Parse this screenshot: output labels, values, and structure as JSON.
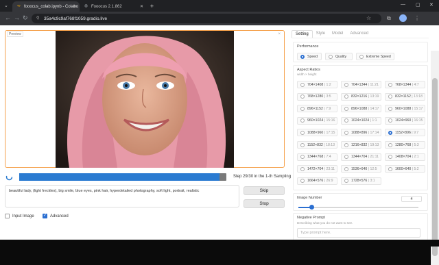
{
  "browser": {
    "tabs": [
      {
        "label": "fooocus_colab.ipynb - Colabo",
        "active": true
      },
      {
        "label": "Fooocus 2.1.862",
        "active": false
      }
    ],
    "url": "35a4c9c9af768f1059.gradio.live"
  },
  "preview": {
    "label": "Preview"
  },
  "progress": {
    "fraction": 0.967,
    "text": "Step 29/30 in the 1-th Sampling"
  },
  "prompt": {
    "value": "beautiful lady, (light freckles), big smile, blue eyes, pink hair, hyperdetailed photography, soft light, portrait, realistic"
  },
  "buttons": {
    "skip": "Skip",
    "stop": "Stop"
  },
  "options": {
    "input_image": "Input Image",
    "advanced": "Advanced"
  },
  "settings_tabs": [
    "Setting",
    "Style",
    "Model",
    "Advanced"
  ],
  "performance": {
    "title": "Performance",
    "options": [
      "Speed",
      "Quality",
      "Extreme Speed"
    ],
    "selected": "Speed"
  },
  "aspect": {
    "title": "Aspect Ratios",
    "subtitle": "width × height",
    "selected": "1152×896 | 9:7",
    "items": [
      {
        "main": "704×1408",
        "ratio": "1:2"
      },
      {
        "main": "704×1344",
        "ratio": "11:21"
      },
      {
        "main": "768×1344",
        "ratio": "4:7"
      },
      {
        "main": "768×1280",
        "ratio": "3:5"
      },
      {
        "main": "832×1216",
        "ratio": "13:19"
      },
      {
        "main": "832×1152",
        "ratio": "13:18"
      },
      {
        "main": "896×1152",
        "ratio": "7:9"
      },
      {
        "main": "896×1088",
        "ratio": "14:17"
      },
      {
        "main": "960×1088",
        "ratio": "15:17"
      },
      {
        "main": "960×1024",
        "ratio": "15:16"
      },
      {
        "main": "1024×1024",
        "ratio": "1:1"
      },
      {
        "main": "1024×960",
        "ratio": "16:15"
      },
      {
        "main": "1088×960",
        "ratio": "17:15"
      },
      {
        "main": "1088×896",
        "ratio": "17:14"
      },
      {
        "main": "1152×896",
        "ratio": "9:7"
      },
      {
        "main": "1152×832",
        "ratio": "18:13"
      },
      {
        "main": "1216×832",
        "ratio": "19:13"
      },
      {
        "main": "1280×768",
        "ratio": "5:3"
      },
      {
        "main": "1344×768",
        "ratio": "7:4"
      },
      {
        "main": "1344×704",
        "ratio": "21:11"
      },
      {
        "main": "1408×704",
        "ratio": "2:1"
      },
      {
        "main": "1472×704",
        "ratio": "23:11"
      },
      {
        "main": "1536×640",
        "ratio": "12:5"
      },
      {
        "main": "1600×640",
        "ratio": "5:2"
      },
      {
        "main": "1664×576",
        "ratio": "26:9"
      },
      {
        "main": "1728×576",
        "ratio": "3:1"
      }
    ]
  },
  "image_number": {
    "title": "Image Number",
    "value": "4",
    "fraction": 0.11
  },
  "negative_prompt": {
    "title": "Negative Prompt",
    "description": "Describing what you do not want to see.",
    "placeholder": "Type prompt here."
  },
  "colors": {
    "accent": "#2b6fd1",
    "preview_border": "#f5a04a",
    "progress_track": "#7a7a7a"
  }
}
